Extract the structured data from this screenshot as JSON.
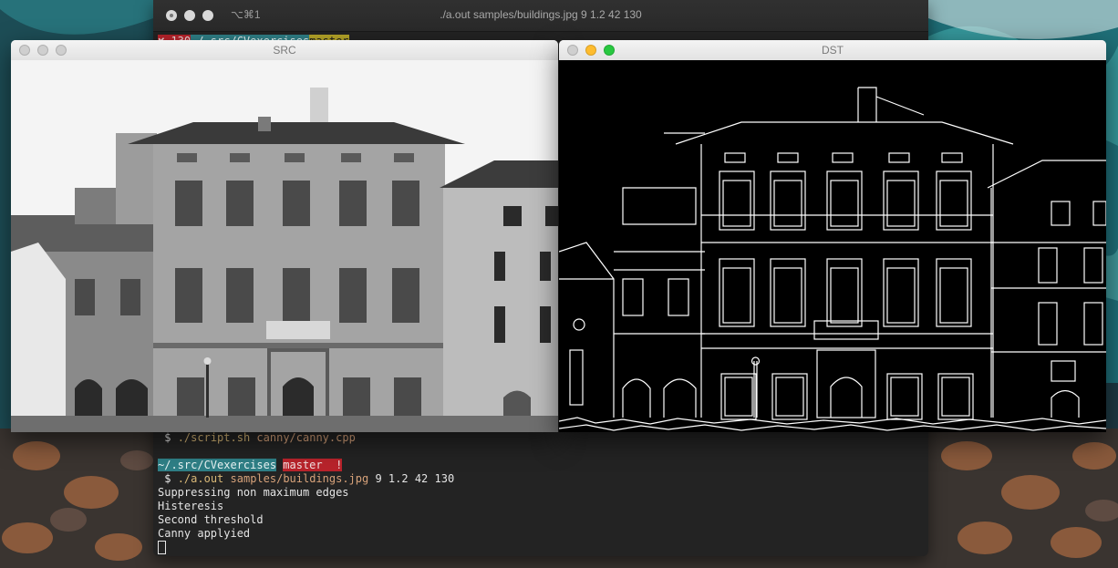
{
  "terminal": {
    "shortcut": "⌥⌘1",
    "title": "./a.out samples/buildings.jpg 9 1.2 42 130",
    "top_prompt": {
      "status": "✘ 130",
      "dir": "~/.src/CVexercises",
      "branch": "master"
    },
    "script_line": {
      "dollar": "$",
      "script": "./script.sh",
      "arg": "canny/canny.cpp"
    },
    "prompt": {
      "dir": "~/.src/CVexercises",
      "branch": "master  !"
    },
    "command": {
      "dollar": "$",
      "exe": "./a.out",
      "file": "samples/buildings.jpg",
      "args": "9 1.2 42 130"
    },
    "output": [
      "Suppressing non maximum edges",
      "Histeresis",
      "Second threshold",
      "Canny applyied"
    ]
  },
  "windows": {
    "src": {
      "title": "SRC"
    },
    "dst": {
      "title": "DST"
    }
  },
  "colors": {
    "terminal_bg": "#232323",
    "segment_red": "#b8232b",
    "segment_teal": "#2f7f86",
    "segment_yellow": "#b6a628"
  }
}
